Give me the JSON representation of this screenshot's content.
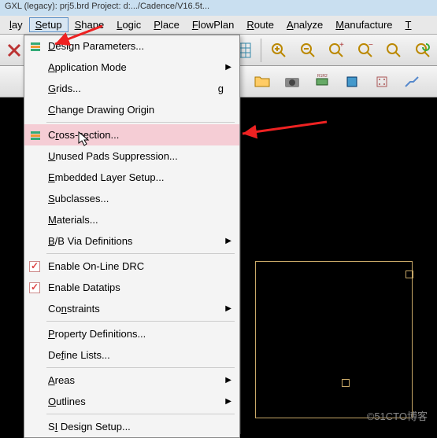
{
  "title": "GXL (legacy): prj5.brd  Project: d:.../Cadence/V16.5t...",
  "menubar": {
    "items": [
      "lay",
      "Setup",
      "Shape",
      "Logic",
      "Place",
      "FlowPlan",
      "Route",
      "Analyze",
      "Manufacture",
      "T"
    ],
    "underlines": [
      "l",
      "S",
      "S",
      "L",
      "P",
      "F",
      "R",
      "A",
      "M",
      "T"
    ],
    "open_index": 1
  },
  "dropdown": {
    "items": [
      {
        "label": "Design Parameters...",
        "u": "D",
        "icon": "params-icon"
      },
      {
        "label": "Application Mode",
        "u": "A",
        "sub": true
      },
      {
        "label": "Grids...",
        "u": "G",
        "short": "g"
      },
      {
        "label": "Change Drawing Origin",
        "u": "C"
      },
      {
        "sep": true
      },
      {
        "label": "Cross-section...",
        "u": "r",
        "icon": "layers-icon",
        "hl": true
      },
      {
        "label": "Unused Pads Suppression...",
        "u": "U"
      },
      {
        "label": "Embedded Layer Setup...",
        "u": "E"
      },
      {
        "label": "Subclasses...",
        "u": "S"
      },
      {
        "label": "Materials...",
        "u": "M"
      },
      {
        "label": "B/B Via Definitions",
        "u": "B",
        "sub": true
      },
      {
        "sep": true
      },
      {
        "label": "Enable On-Line DRC",
        "check": true
      },
      {
        "label": "Enable Datatips",
        "check": true
      },
      {
        "label": "Constraints",
        "u": "n",
        "sub": true
      },
      {
        "sep": true
      },
      {
        "label": "Property Definitions...",
        "u": "P"
      },
      {
        "label": "Define Lists...",
        "u": "f"
      },
      {
        "sep": true
      },
      {
        "label": "Areas",
        "u": "A",
        "sub": true
      },
      {
        "label": "Outlines",
        "u": "O",
        "sub": true
      },
      {
        "sep": true
      },
      {
        "label": "SI Design Setup...",
        "u": "I"
      }
    ]
  },
  "watermark": "©51CTO博客"
}
